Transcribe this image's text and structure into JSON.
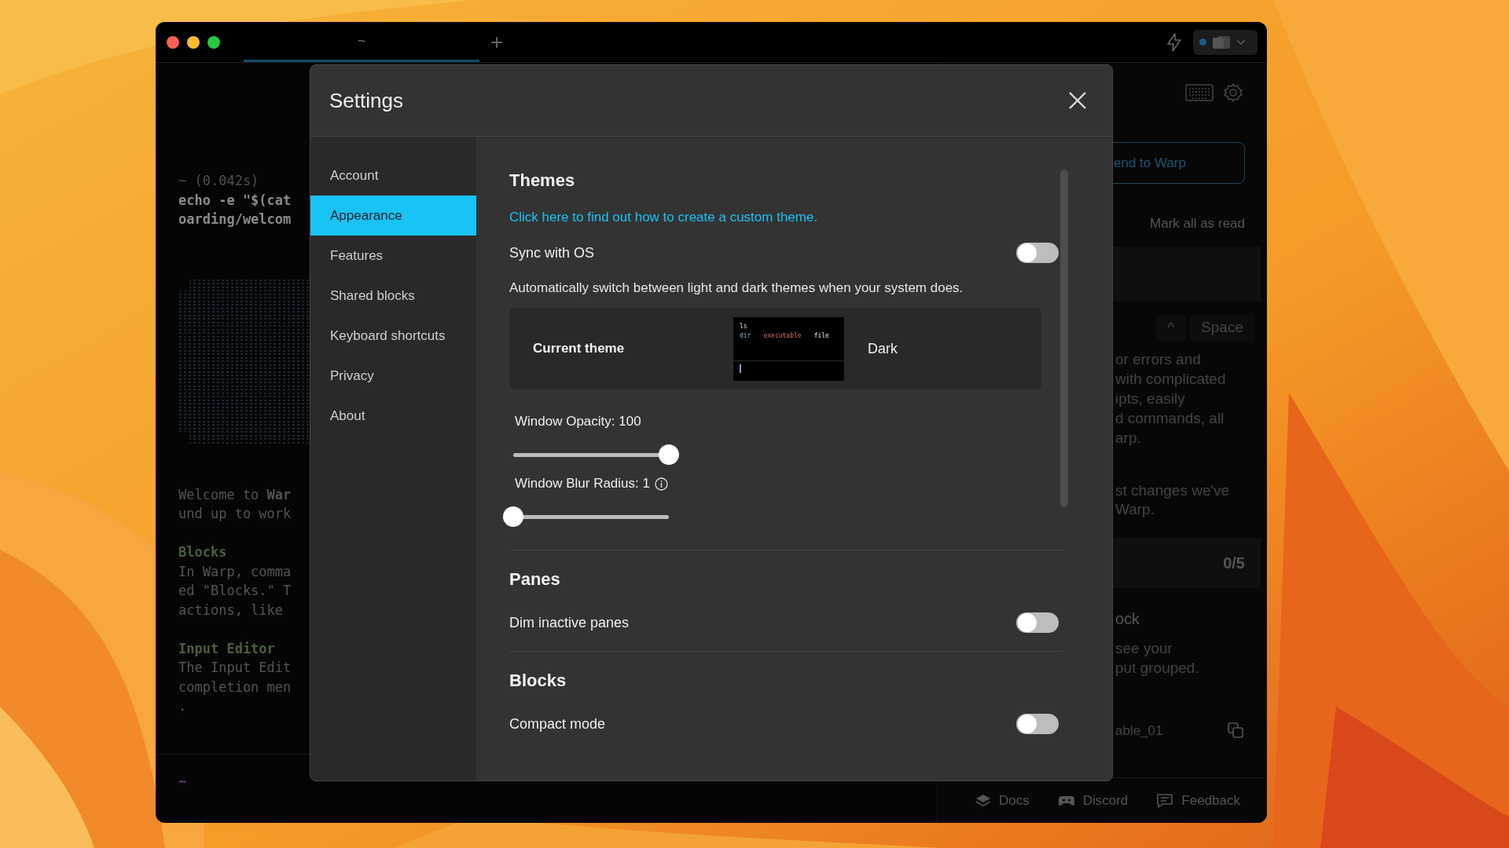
{
  "title_bar": {
    "tabs": [
      {
        "label": "~",
        "selected": true
      }
    ],
    "new_tab": "+"
  },
  "terminal": {
    "lines": [
      {
        "kind": "prompt",
        "text": "~ (0.042s)"
      },
      {
        "kind": "command",
        "text": "echo -e \"$(cat"
      },
      {
        "kind": "command",
        "text": "oarding/welcom"
      },
      {
        "kind": "art"
      },
      {
        "kind": "text",
        "text": "Welcome to **War**"
      },
      {
        "kind": "text",
        "text": "und up to work"
      },
      {
        "kind": "blank"
      },
      {
        "kind": "heading",
        "text": "Blocks"
      },
      {
        "kind": "text",
        "text": "In Warp, comma"
      },
      {
        "kind": "text",
        "text": "ed \"Blocks.\" T"
      },
      {
        "kind": "text",
        "text": "actions, like"
      },
      {
        "kind": "blank"
      },
      {
        "kind": "heading",
        "text": "Input Editor"
      },
      {
        "kind": "text",
        "text": "The Input Edit"
      },
      {
        "kind": "text",
        "text": "completion men"
      },
      {
        "kind": "text",
        "text": "."
      }
    ],
    "input_prompt": "~"
  },
  "side_panel": {
    "action_button": "end to Warp",
    "mark_read": "Mark all as read",
    "keys": [
      "^",
      "Space"
    ],
    "paragraph_1": [
      "or errors and",
      "with complicated",
      "ipts, easily",
      "d commands, all",
      "arp."
    ],
    "paragraph_2": [
      "st changes we've",
      "Warp."
    ],
    "progress": "0/5",
    "task_title": "ock",
    "task_text": [
      "see your",
      "put grouped."
    ],
    "snippet": "able_01",
    "footer": [
      "Docs",
      "Discord",
      "Feedback"
    ]
  },
  "settings": {
    "title": "Settings",
    "nav": [
      {
        "label": "Account",
        "selected": false
      },
      {
        "label": "Appearance",
        "selected": true
      },
      {
        "label": "Features",
        "selected": false
      },
      {
        "label": "Shared blocks",
        "selected": false
      },
      {
        "label": "Keyboard shortcuts",
        "selected": false
      },
      {
        "label": "Privacy",
        "selected": false
      },
      {
        "label": "About",
        "selected": false
      }
    ],
    "sections": [
      {
        "heading": "Themes",
        "items": [
          {
            "kind": "link",
            "text": "Click here to find out how to create a custom theme."
          },
          {
            "kind": "toggle",
            "label": "Sync with OS",
            "on": false
          },
          {
            "kind": "description",
            "text": "Automatically switch between light and dark themes when your system does."
          },
          {
            "kind": "theme_card",
            "label": "Current theme",
            "preview": [
              "ls",
              "dir",
              "executable",
              "file"
            ],
            "name": "Dark"
          },
          {
            "kind": "slider",
            "label": "Window Opacity: 100",
            "level": 1,
            "info": false
          },
          {
            "kind": "slider",
            "label": "Window Blur Radius: 1",
            "level": 0,
            "info": true
          }
        ]
      },
      {
        "heading": "Panes",
        "items": [
          {
            "kind": "toggle",
            "label": "Dim inactive panes",
            "on": false
          }
        ]
      },
      {
        "heading": "Blocks",
        "items": [
          {
            "kind": "toggle",
            "label": "Compact mode",
            "on": false
          }
        ]
      }
    ]
  }
}
